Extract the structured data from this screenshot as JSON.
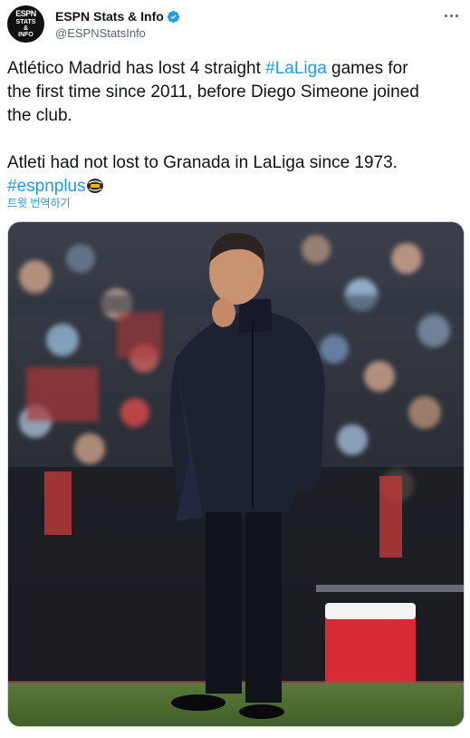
{
  "author": {
    "display_name": "ESPN Stats & Info",
    "handle": "@ESPNStatsInfo",
    "avatar_logo": "ESPN",
    "avatar_text": [
      "STATS",
      "&",
      "INFO"
    ]
  },
  "tweet": {
    "line1_a": "Atlético Madrid has lost 4 straight ",
    "line1_hashtag": "#LaLiga",
    "line1_b": " games for",
    "line2": "the first time since 2011, before Diego Simeone joined",
    "line3": "the club.",
    "line4": "Atleti had not lost to Granada in LaLiga since 1973.",
    "hashtag2": "#espnplus"
  },
  "translate_label": "트윗 번역하기",
  "icons": {
    "verified": "verified-badge-icon",
    "more": "more-options-icon",
    "emoji": "espn-plus-ball-emoji-icon"
  },
  "colors": {
    "link": "#1d9bf0",
    "text": "#0f1419",
    "secondary": "#536471"
  }
}
